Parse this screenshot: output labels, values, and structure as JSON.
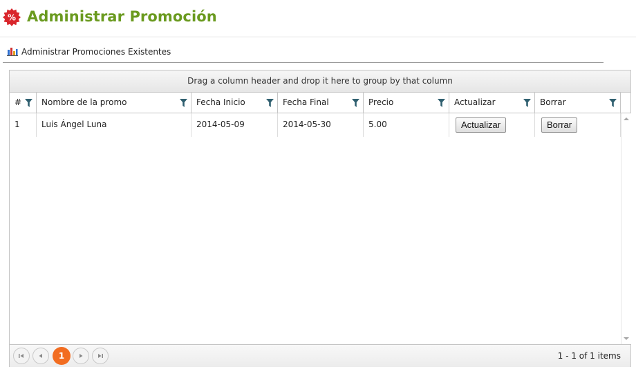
{
  "header": {
    "badge_symbol": "%",
    "title": "Administrar Promoción",
    "accent_color": "#6a9a1f",
    "badge_color": "#d9262c"
  },
  "section": {
    "icon": "bar-chart-icon",
    "label": "Administrar Promociones Existentes"
  },
  "grid": {
    "group_hint": "Drag a column header and drop it here to group by that column",
    "columns": [
      {
        "label": "#"
      },
      {
        "label": "Nombre de la promo"
      },
      {
        "label": "Fecha Inicio"
      },
      {
        "label": "Fecha Final"
      },
      {
        "label": "Precio"
      },
      {
        "label": "Actualizar"
      },
      {
        "label": "Borrar"
      }
    ],
    "rows": [
      {
        "num": "1",
        "nombre": "Luis Ángel Luna",
        "fecha_inicio": "2014-05-09",
        "fecha_final": "2014-05-30",
        "precio": "5.00",
        "actualizar_label": "Actualizar",
        "borrar_label": "Borrar"
      }
    ],
    "pager": {
      "current_page": "1",
      "info": "1 - 1 of 1 items",
      "current_color": "#f26d21"
    }
  }
}
